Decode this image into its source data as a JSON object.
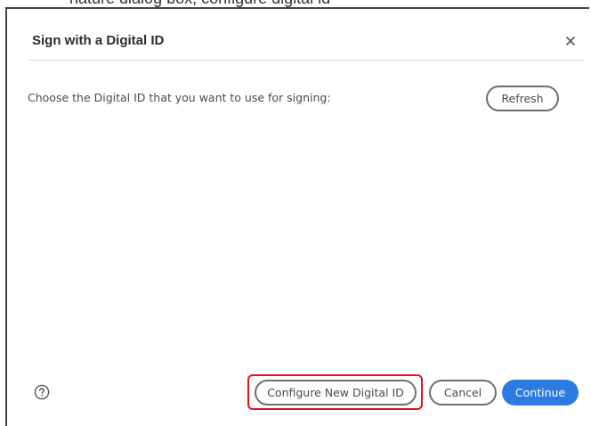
{
  "background": {
    "cropped_text": "nature dialog box, configure digital id"
  },
  "dialog": {
    "title": "Sign with a Digital ID",
    "close_icon": "close-icon",
    "prompt": "Choose the Digital ID that you want to use for signing:",
    "refresh_label": "Refresh",
    "help_icon": "help-icon",
    "configure_label": "Configure New Digital ID",
    "cancel_label": "Cancel",
    "continue_label": "Continue"
  },
  "colors": {
    "primary_button": "#2d7be0",
    "highlight": "#e0121c",
    "border": "#454545"
  }
}
